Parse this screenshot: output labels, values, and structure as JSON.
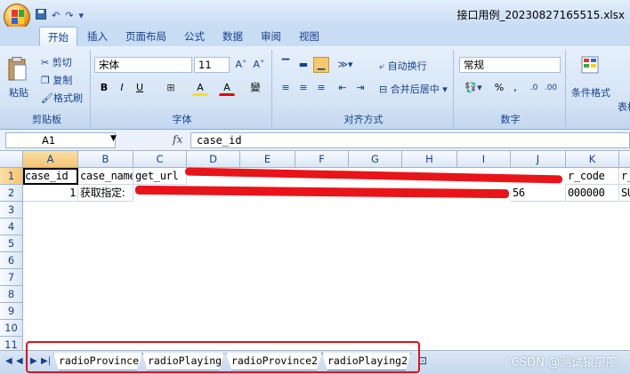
{
  "window": {
    "title": "接口用例_20230827165515.xlsx"
  },
  "quick_access": {
    "undo": "↶",
    "redo": "↷",
    "more": "▾"
  },
  "ribbon_tabs": [
    "开始",
    "插入",
    "页面布局",
    "公式",
    "数据",
    "审阅",
    "视图"
  ],
  "clipboard": {
    "paste": "粘贴",
    "cut": "剪切",
    "copy": "复制",
    "format_painter": "格式刷",
    "label": "剪贴板"
  },
  "font": {
    "name": "宋体",
    "size": "11",
    "grow": "A˄",
    "shrink": "A˅",
    "bold": "B",
    "italic": "I",
    "underline": "U",
    "border": "⊞",
    "fill": "A",
    "color": "A",
    "phonetic": "變",
    "label": "字体"
  },
  "alignment": {
    "wrap": "自动换行",
    "merge": "合并后居中",
    "label": "对齐方式"
  },
  "number": {
    "format": "常规",
    "percent": "%",
    "comma": ",",
    "label": "数字"
  },
  "styles": {
    "conditional": "条件格式",
    "table": "表格"
  },
  "formula_bar": {
    "cell_ref": "A1",
    "fx": "fx",
    "content": "case_id"
  },
  "columns": [
    "A",
    "B",
    "C",
    "D",
    "E",
    "F",
    "G",
    "H",
    "I",
    "J",
    "K",
    "L"
  ],
  "rows": [
    "1",
    "2",
    "3",
    "4",
    "5",
    "6",
    "7",
    "8",
    "9",
    "10",
    "11"
  ],
  "cells": {
    "header": {
      "A": "case_id",
      "B": "case_name",
      "C": "get_url",
      "K": "r_code",
      "L": "r_"
    },
    "row2": {
      "A": "1",
      "B": "获取指定:",
      "J": "56",
      "K": "000000",
      "L": "SU"
    }
  },
  "sheets": [
    "radioProvince",
    "radioPlaying",
    "radioProvince2",
    "radioPlaying2"
  ],
  "active_sheet": "radioPlaying2",
  "watermark": "CSDN @测试猿廖廖",
  "colors": {
    "redaction": "#e8141a",
    "highlight": "#e2101a",
    "ribbon_text": "#15428b"
  }
}
